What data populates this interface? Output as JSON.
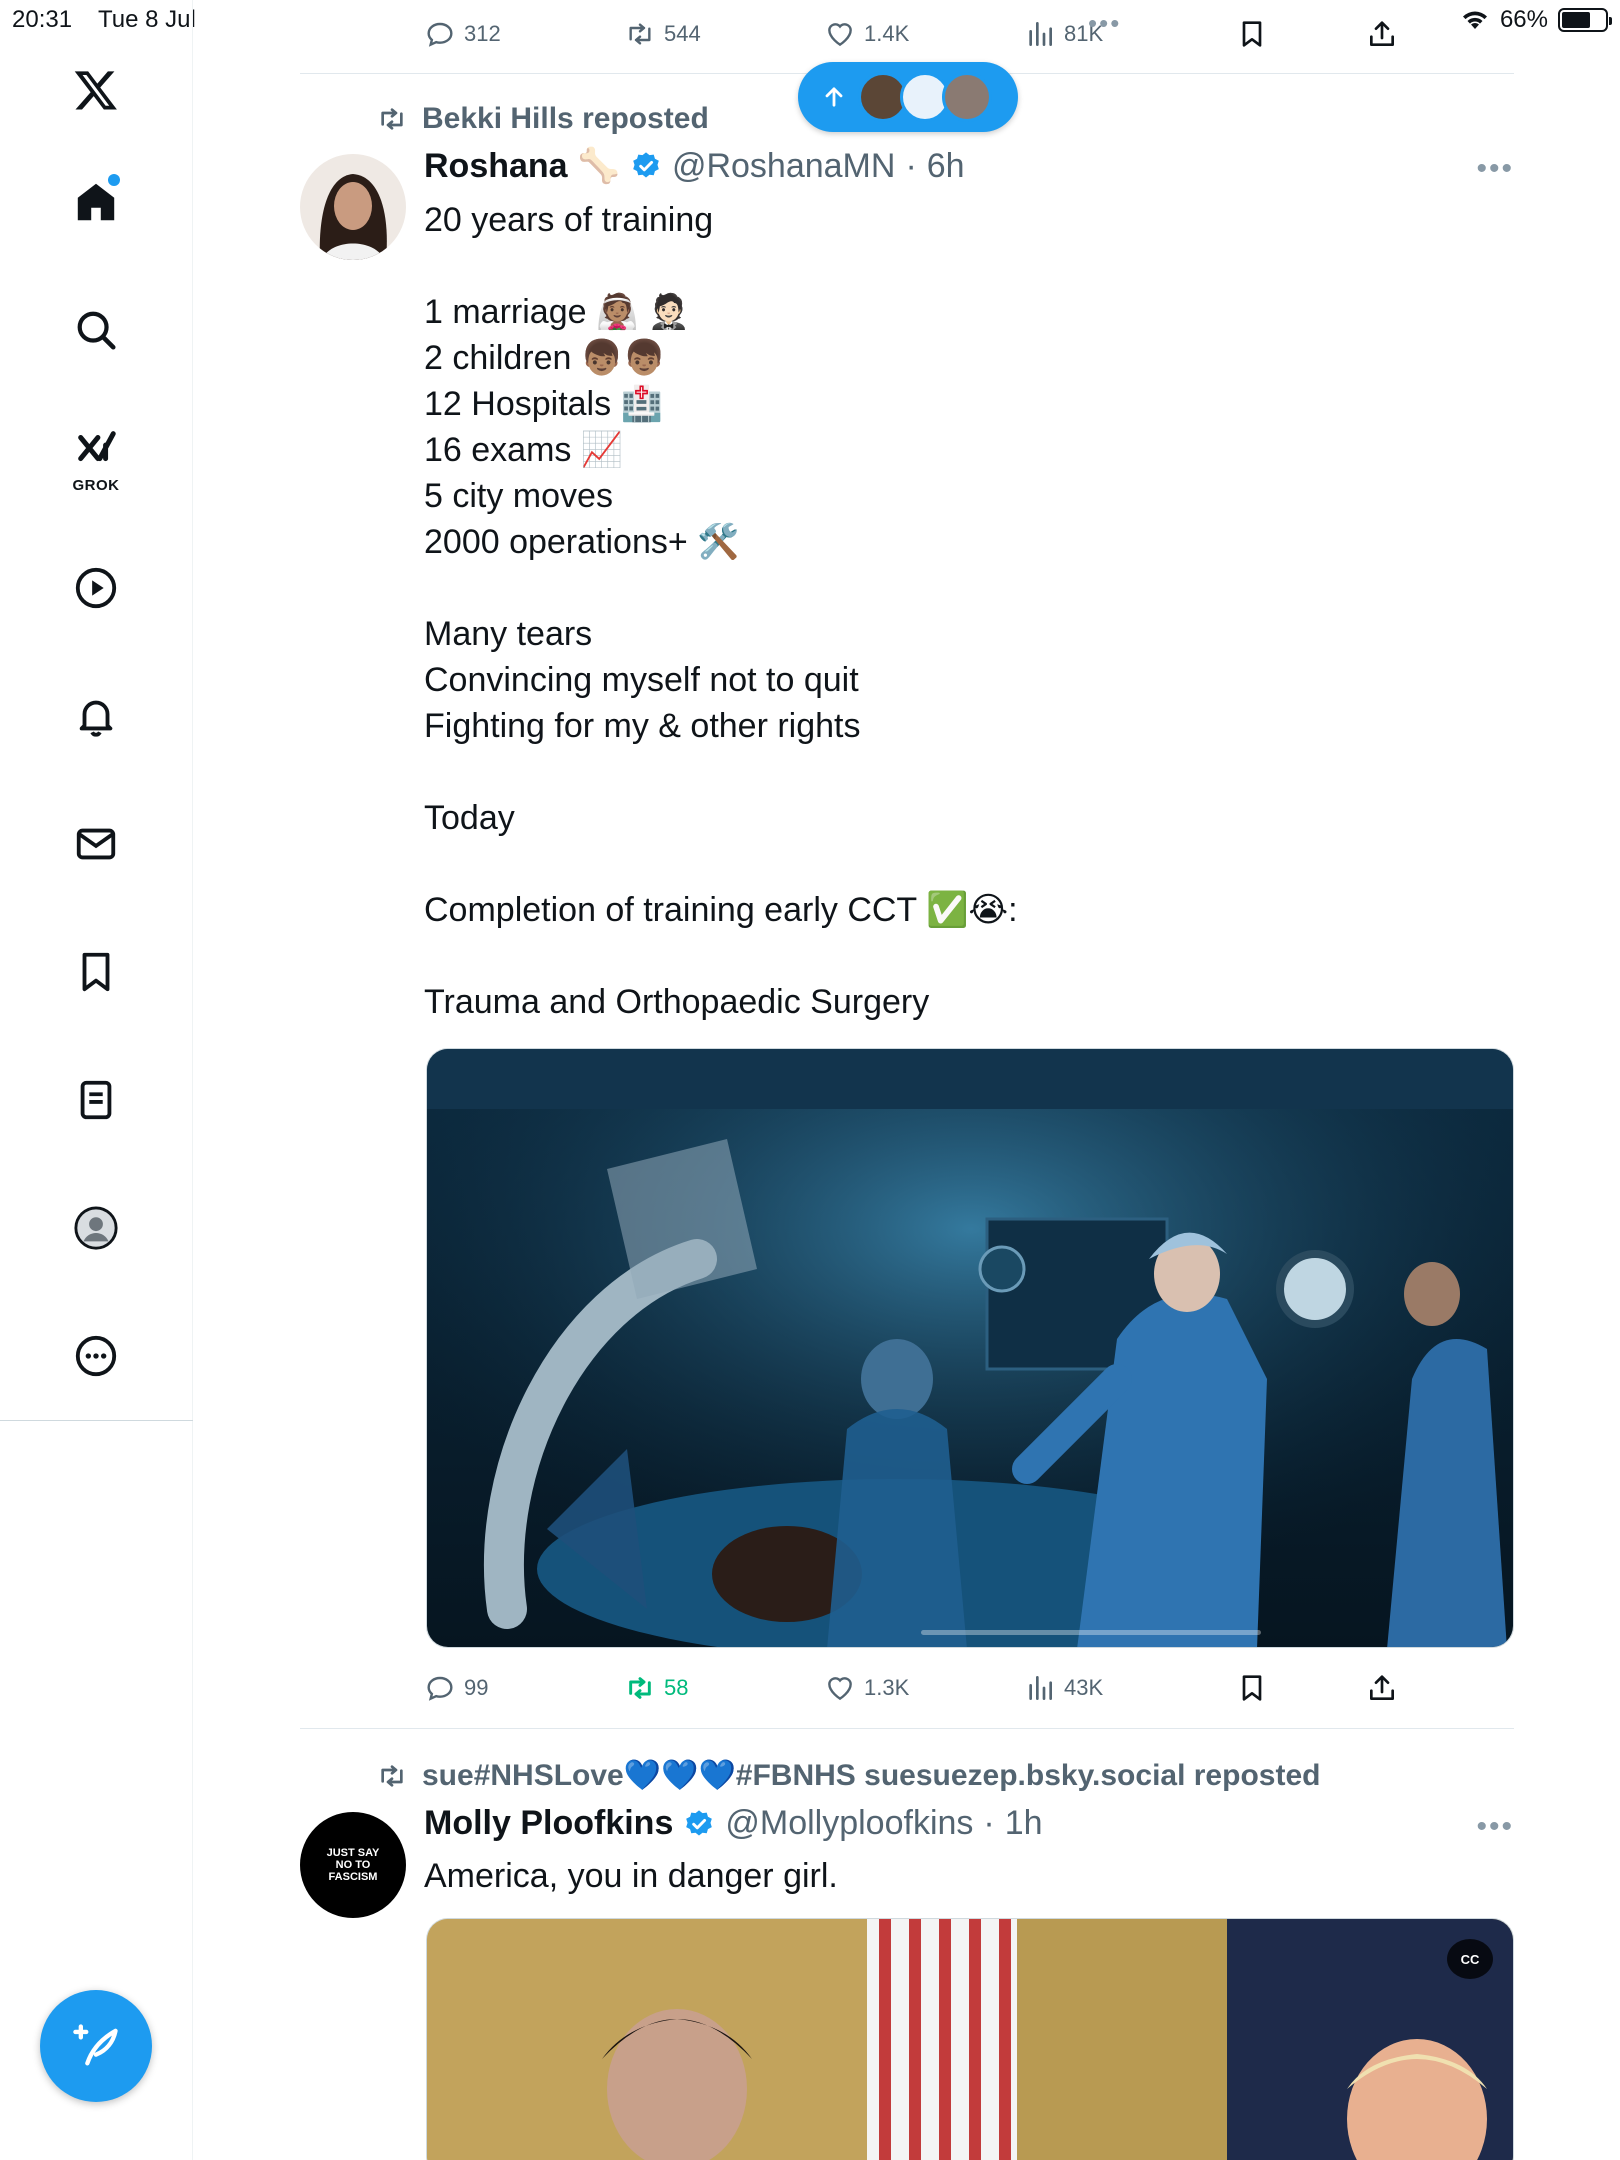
{
  "status_bar": {
    "time": "20:31",
    "date": "Tue 8 Jul",
    "battery": "66%",
    "battery_level": 0.66
  },
  "sidebar": {
    "grok_label": "GROK",
    "icons": [
      "x-logo-icon",
      "home-icon",
      "search-icon",
      "grok-icon",
      "video-icon",
      "notifications-icon",
      "messages-icon",
      "bookmarks-icon",
      "lists-icon",
      "profile-icon",
      "more-icon",
      "compose-icon"
    ]
  },
  "prev_tweet_actions": {
    "replies": "312",
    "retweets": "544",
    "likes": "1.4K",
    "views": "81K"
  },
  "tweets": [
    {
      "reposted_by": "Bekki Hills reposted",
      "name": "Roshana",
      "name_emoji": "🦴",
      "handle": "@RoshanaMN",
      "time": "6h",
      "lines": [
        "20 years of training",
        "",
        "1 marriage 👰🏽 🤵🏻",
        "2 children 👦🏽👦🏽",
        "12 Hospitals 🏥",
        "16 exams 📈",
        "5 city moves",
        "2000 operations+ 🛠️",
        "",
        "Many tears",
        "Convincing myself not to quit",
        "Fighting for my & other rights",
        "",
        "Today",
        "",
        "Completion of training early CCT ✅😭:",
        "",
        "Trauma and Orthopaedic Surgery"
      ],
      "replies": "99",
      "retweets": "58",
      "likes": "1.3K",
      "views": "43K"
    },
    {
      "reposted_by": "sue#NHSLove💙💙💙#FBNHS suesuezep.bsky.social reposted",
      "name": "Molly Ploofkins",
      "handle": "@Mollyploofkins",
      "time": "1h",
      "avatar_text": "JUST SAY NO TO FASCISM",
      "text": "America, you in danger girl.",
      "cc_label": "CC"
    }
  ],
  "colors": {
    "accent": "#1d9bf0",
    "retweet_active": "#00ba7c",
    "muted": "#536471"
  }
}
